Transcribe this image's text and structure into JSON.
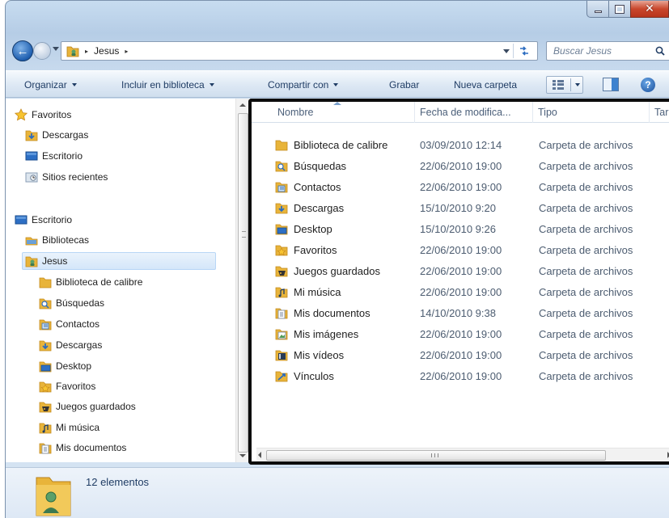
{
  "window": {
    "caption_minimize": "–",
    "caption_maximize": "□",
    "caption_close": "✕"
  },
  "address": {
    "breadcrumb": [
      "Jesus"
    ],
    "separator": "▸",
    "search_placeholder": "Buscar Jesus"
  },
  "toolbar": {
    "organize": "Organizar",
    "include_library": "Incluir en biblioteca",
    "share_with": "Compartir con",
    "burn": "Grabar",
    "new_folder": "Nueva carpeta",
    "help": "?"
  },
  "nav_pane": {
    "items": [
      {
        "label": "Favoritos",
        "icon": "star-icon",
        "level": 0
      },
      {
        "label": "Descargas",
        "icon": "downloads-folder-icon",
        "level": 1
      },
      {
        "label": "Escritorio",
        "icon": "desktop-icon",
        "level": 1
      },
      {
        "label": "Sitios recientes",
        "icon": "recent-places-icon",
        "level": 1
      },
      {
        "label": "Escritorio",
        "icon": "desktop-icon",
        "level": 0
      },
      {
        "label": "Bibliotecas",
        "icon": "libraries-icon",
        "level": 1
      },
      {
        "label": "Jesus",
        "icon": "user-folder-icon",
        "level": 1,
        "selected": true
      },
      {
        "label": "Biblioteca de calibre",
        "icon": "folder-icon",
        "level": 2
      },
      {
        "label": "Búsquedas",
        "icon": "searches-folder-icon",
        "level": 2
      },
      {
        "label": "Contactos",
        "icon": "contacts-folder-icon",
        "level": 2
      },
      {
        "label": "Descargas",
        "icon": "downloads-folder-icon",
        "level": 2
      },
      {
        "label": "Desktop",
        "icon": "desktop-folder-icon",
        "level": 2
      },
      {
        "label": "Favoritos",
        "icon": "favorites-folder-icon",
        "level": 2
      },
      {
        "label": "Juegos guardados",
        "icon": "saved-games-folder-icon",
        "level": 2
      },
      {
        "label": "Mi música",
        "icon": "music-folder-icon",
        "level": 2
      },
      {
        "label": "Mis documentos",
        "icon": "documents-folder-icon",
        "level": 2
      }
    ]
  },
  "content": {
    "columns": [
      "Nombre",
      "Fecha de modifica...",
      "Tipo",
      "Tar"
    ],
    "rows": [
      {
        "name": "Biblioteca de calibre",
        "date": "03/09/2010 12:14",
        "type": "Carpeta de archivos",
        "icon": "folder-icon"
      },
      {
        "name": "Búsquedas",
        "date": "22/06/2010 19:00",
        "type": "Carpeta de archivos",
        "icon": "searches-folder-icon"
      },
      {
        "name": "Contactos",
        "date": "22/06/2010 19:00",
        "type": "Carpeta de archivos",
        "icon": "contacts-folder-icon"
      },
      {
        "name": "Descargas",
        "date": "15/10/2010 9:20",
        "type": "Carpeta de archivos",
        "icon": "downloads-folder-icon"
      },
      {
        "name": "Desktop",
        "date": "15/10/2010 9:26",
        "type": "Carpeta de archivos",
        "icon": "desktop-folder-icon"
      },
      {
        "name": "Favoritos",
        "date": "22/06/2010 19:00",
        "type": "Carpeta de archivos",
        "icon": "favorites-folder-icon"
      },
      {
        "name": "Juegos guardados",
        "date": "22/06/2010 19:00",
        "type": "Carpeta de archivos",
        "icon": "saved-games-folder-icon"
      },
      {
        "name": "Mi música",
        "date": "22/06/2010 19:00",
        "type": "Carpeta de archivos",
        "icon": "music-folder-icon"
      },
      {
        "name": "Mis documentos",
        "date": "14/10/2010 9:38",
        "type": "Carpeta de archivos",
        "icon": "documents-folder-icon"
      },
      {
        "name": "Mis imágenes",
        "date": "22/06/2010 19:00",
        "type": "Carpeta de archivos",
        "icon": "pictures-folder-icon"
      },
      {
        "name": "Mis vídeos",
        "date": "22/06/2010 19:00",
        "type": "Carpeta de archivos",
        "icon": "videos-folder-icon"
      },
      {
        "name": "Vínculos",
        "date": "22/06/2010 19:00",
        "type": "Carpeta de archivos",
        "icon": "links-folder-icon"
      }
    ]
  },
  "details": {
    "item_count": "12 elementos"
  },
  "colors": {
    "folder": "#e8b43a",
    "folder_dark": "#c48a1c",
    "accent_blue": "#2b6cc0",
    "selection": "#d4e6f9"
  }
}
